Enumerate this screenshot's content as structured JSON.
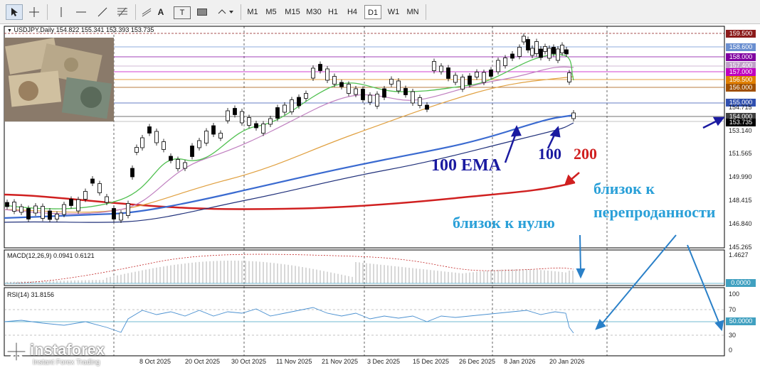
{
  "toolbar": {
    "icons": [
      "cursor-icon",
      "crosshair-icon",
      "vertical-line-icon",
      "horizontal-line-icon",
      "trendline-icon",
      "fibonacci-icon",
      "text-icon",
      "label-icon",
      "rectangle-icon",
      "shapes-dropdown-icon"
    ],
    "text_tool_label": "A",
    "label_tool_label": "T",
    "timeframes": [
      "M1",
      "M5",
      "M15",
      "M30",
      "H1",
      "H4",
      "D1",
      "W1",
      "MN"
    ],
    "active_timeframe": "D1"
  },
  "main_chart": {
    "header": "USDJPY,Daily  154.822 155.341 153.393 153.735",
    "price_tags": [
      {
        "value": "159.500",
        "color": "#8b1a1a"
      },
      {
        "value": "158.600",
        "color": "#6a8fd0"
      },
      {
        "value": "158.000",
        "color": "#8000a0"
      },
      {
        "value": "157.400",
        "color": "#c0a0c8"
      },
      {
        "value": "157.000",
        "color": "#c000c0"
      },
      {
        "value": "156.500",
        "color": "#e08000"
      },
      {
        "value": "156.000",
        "color": "#a05000"
      },
      {
        "value": "155.000",
        "color": "#3050b0"
      },
      {
        "value": "154.000",
        "color": "#404040"
      },
      {
        "value": "153.735",
        "color": "#000000"
      }
    ],
    "axis_labels": [
      "154.715",
      "153.140",
      "151.565",
      "149.990",
      "148.415",
      "146.840",
      "145.265"
    ],
    "date_labels": [
      "8 Oct 2025",
      "20 Oct 2025",
      "30 Oct 2025",
      "11 Nov 2025",
      "21 Nov 2025",
      "3 Dec 2025",
      "15 Dec 2025",
      "26 Dec 2025",
      "8 Jan 2026",
      "20 Jan 2026"
    ],
    "annotations": {
      "ema100": "100 EMA",
      "label100": "100",
      "label200": "200",
      "near_zero": "близок к нулю",
      "oversold_line1": "близок к",
      "oversold_line2": "перепроданности"
    }
  },
  "macd_panel": {
    "header": "MACD(12,26,9) 0.0941 0.6121",
    "axis_top": "1.4627",
    "zero_tag": "0.0000"
  },
  "rsi_panel": {
    "header": "RSI(14) 31.8156",
    "axis_labels": [
      "100",
      "70",
      "30",
      "0"
    ],
    "level_tag": "50.0000"
  },
  "logo": {
    "brand": "instaforex",
    "tagline": "Instant Forex Trading"
  },
  "colors": {
    "bull": "#000000",
    "ema_short": "#40c040",
    "ema_mid": "#c080c0",
    "ema_long": "#e0a040",
    "ema100": "#3060c0",
    "ema200": "#d02020",
    "annotation_blue": "#1a1aa0",
    "annotation_cyan": "#2aa0d8"
  }
}
